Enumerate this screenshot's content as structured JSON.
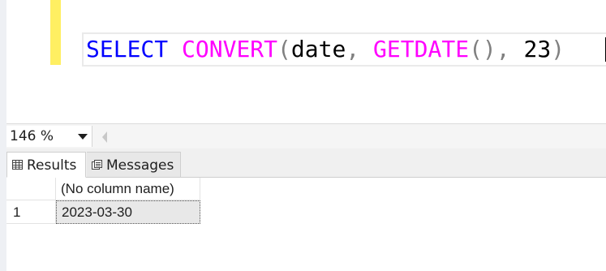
{
  "editor": {
    "code_tokens": [
      {
        "text": "SELECT",
        "kind": "keyword"
      },
      {
        "text": " ",
        "kind": "text"
      },
      {
        "text": "CONVERT",
        "kind": "function"
      },
      {
        "text": "(",
        "kind": "punct"
      },
      {
        "text": "date",
        "kind": "text"
      },
      {
        "text": ",",
        "kind": "punct"
      },
      {
        "text": " ",
        "kind": "text"
      },
      {
        "text": "GETDATE",
        "kind": "function"
      },
      {
        "text": "()",
        "kind": "punct"
      },
      {
        "text": ",",
        "kind": "punct"
      },
      {
        "text": " 23",
        "kind": "text"
      },
      {
        "text": ")",
        "kind": "punct"
      }
    ],
    "colors": {
      "keyword": "#0000ff",
      "function": "#ff00ff",
      "punct": "#808080",
      "text": "#000000",
      "change_bar": "#ffef62"
    }
  },
  "zoom": {
    "value": "146 %"
  },
  "results_tabs": [
    {
      "label": "Results",
      "icon": "grid-icon",
      "active": true
    },
    {
      "label": "Messages",
      "icon": "messages-icon",
      "active": false
    }
  ],
  "grid": {
    "columns": [
      "(No column name)"
    ],
    "rows": [
      {
        "row_number": "1",
        "cells": [
          "2023-03-30"
        ]
      }
    ]
  }
}
